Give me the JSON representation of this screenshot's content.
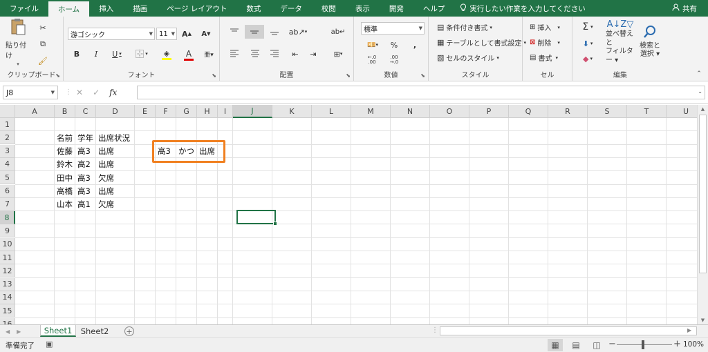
{
  "menu": {
    "tabs": [
      "ファイル",
      "ホーム",
      "挿入",
      "描画",
      "ページ レイアウト",
      "数式",
      "データ",
      "校閲",
      "表示",
      "開発",
      "ヘルプ"
    ],
    "active_tab": "ホーム",
    "tell_me": "実行したい作業を入力してください",
    "share": "共有"
  },
  "ribbon": {
    "clipboard": {
      "label": "クリップボード",
      "paste": "貼り付け"
    },
    "font": {
      "label": "フォント",
      "name": "游ゴシック",
      "size": "11"
    },
    "alignment": {
      "label": "配置"
    },
    "number": {
      "label": "数値",
      "format": "標準"
    },
    "styles": {
      "label": "スタイル",
      "conditional": "条件付き書式",
      "table": "テーブルとして書式設定",
      "cell_styles": "セルのスタイル"
    },
    "cells": {
      "label": "セル",
      "insert": "挿入",
      "delete": "削除",
      "format": "書式"
    },
    "editing": {
      "label": "編集",
      "sort_line1": "並べ替えと",
      "sort_line2": "フィルター",
      "find_line1": "検索と",
      "find_line2": "選択"
    }
  },
  "formula_bar": {
    "name_box": "J8",
    "fx": "fx",
    "value": ""
  },
  "columns": [
    "A",
    "B",
    "C",
    "D",
    "E",
    "F",
    "G",
    "H",
    "I",
    "J",
    "K",
    "L",
    "M",
    "N",
    "O",
    "P",
    "Q",
    "R",
    "S",
    "T",
    "U"
  ],
  "rows": [
    "1",
    "2",
    "3",
    "4",
    "5",
    "6",
    "7",
    "8",
    "9",
    "10",
    "11",
    "12",
    "13",
    "14",
    "15",
    "16"
  ],
  "selected_cell": "J8",
  "table": {
    "headers": [
      "名前",
      "学年",
      "出席状況"
    ],
    "rows": [
      [
        "佐藤",
        "高3",
        "出席"
      ],
      [
        "鈴木",
        "高2",
        "出席"
      ],
      [
        "田中",
        "高3",
        "欠席"
      ],
      [
        "高橋",
        "高3",
        "出席"
      ],
      [
        "山本",
        "高1",
        "欠席"
      ]
    ]
  },
  "criteria": [
    "高3",
    "かつ",
    "出席"
  ],
  "sheets": [
    "Sheet1",
    "Sheet2"
  ],
  "active_sheet": "Sheet1",
  "status": {
    "ready": "準備完了",
    "zoom": "100%"
  },
  "colors": {
    "accent": "#217346",
    "highlight": "#f08020"
  }
}
